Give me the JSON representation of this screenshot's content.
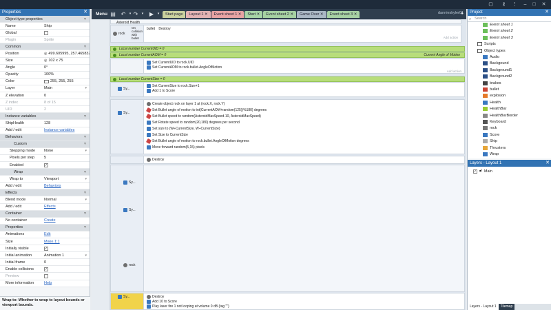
{
  "toolbar": {
    "menu_label": "Menu",
    "user_label": "dannieskyler01",
    "tabs": [
      {
        "label": "Start page",
        "color": "#c9d19e"
      },
      {
        "label": "Layout 1",
        "color": "#e3b3b3"
      },
      {
        "label": "Event sheet 1",
        "color": "#e7a3a3"
      },
      {
        "label": "Start",
        "color": "#a7d4a6"
      },
      {
        "label": "Event sheet 2",
        "color": "#a6d1a2"
      },
      {
        "label": "Game Over",
        "color": "#aab7c4"
      },
      {
        "label": "Event sheet 3",
        "color": "#a7d1a3"
      }
    ]
  },
  "properties": {
    "title": "Properties",
    "rows": [
      {
        "type": "sec",
        "key": "Object type properties"
      },
      {
        "key": "Name",
        "value": "Ship"
      },
      {
        "key": "Global",
        "value": "",
        "check": false
      },
      {
        "key": "Plugin",
        "value": "Sprite",
        "dim": true
      },
      {
        "type": "sec",
        "key": "Common"
      },
      {
        "key": "Position",
        "value": "499.605995, 257.465832",
        "icon": "position-icon"
      },
      {
        "key": "Size",
        "value": "102 x 75",
        "icon": "size-icon"
      },
      {
        "key": "Angle",
        "value": "0°"
      },
      {
        "key": "Opacity",
        "value": "100%"
      },
      {
        "key": "Color",
        "value": "255, 255, 255",
        "swatch": true
      },
      {
        "key": "Layer",
        "value": "Main",
        "dropdown": true
      },
      {
        "key": "Z elevation",
        "value": "0"
      },
      {
        "key": "Z index",
        "value": "8 of 15",
        "dim": true
      },
      {
        "key": "UID",
        "value": "2",
        "dim": true
      },
      {
        "type": "sec",
        "key": "Instance variables"
      },
      {
        "key": "ShipHealth",
        "value": "128"
      },
      {
        "key": "Add / edit",
        "value": "Instance variables",
        "link": true
      },
      {
        "type": "sec",
        "key": "Behaviors"
      },
      {
        "type": "sub",
        "key": "Custom"
      },
      {
        "key": "Stepping mode",
        "value": "None",
        "dropdown": true,
        "sub": true
      },
      {
        "key": "Pixels per step",
        "value": "5",
        "sub": true
      },
      {
        "key": "Enabled",
        "value": "",
        "check": true,
        "sub": true
      },
      {
        "type": "sub",
        "key": "Wrap"
      },
      {
        "key": "Wrap to",
        "value": "Viewport",
        "dropdown": true,
        "sub": true
      },
      {
        "key": "Add / edit",
        "value": "Behaviors",
        "link": true
      },
      {
        "type": "sec",
        "key": "Effects"
      },
      {
        "key": "Blend mode",
        "value": "Normal",
        "dropdown": true
      },
      {
        "key": "Add / edit",
        "value": "Effects",
        "link": true
      },
      {
        "type": "sec",
        "key": "Container"
      },
      {
        "key": "No container",
        "value": "Create",
        "link": true
      },
      {
        "type": "sec",
        "key": "Properties"
      },
      {
        "key": "Animations",
        "value": "Edit",
        "link": true
      },
      {
        "key": "Size",
        "value": "Make 1:1",
        "link": true
      },
      {
        "key": "Initially visible",
        "value": "",
        "check": true
      },
      {
        "key": "Initial animation",
        "value": "Animation 1",
        "dropdown": true
      },
      {
        "key": "Initial frame",
        "value": "0"
      },
      {
        "key": "Enable collisions",
        "value": "",
        "check": true
      },
      {
        "key": "Preview",
        "value": "",
        "check": false,
        "dim": true
      },
      {
        "key": "More information",
        "value": "Help",
        "link": true
      }
    ],
    "tip": "Wrap to: Whether to wrap to layout bounds or viewport bounds."
  },
  "events": {
    "top_text": [
      "Asteroid Health"
    ],
    "e1": {
      "cond_label": "rock",
      "cond_detail": "On collision with bullet",
      "act": "Destroy",
      "act_obj": "bullet"
    },
    "var1": "Local number CurrentUID = 0",
    "var2": "Local number CurrentAOM = 0",
    "var2_right": "Current Angle of Motion",
    "e2": [
      "Set CurrentUID to rock.UID",
      "Set CurrentAOM to rock.bullet.AngleOfMotion"
    ],
    "var3": "Local number CurrentSize = 0",
    "e3": [
      "Set CurrentSize to rock.Size+1",
      "Add 1 to Score"
    ],
    "e4": [
      "Create object  rock on layer 1 at (rock.X, rock.Y)",
      "Set  Bullet angle of motion to int(CurrentAOM+random(125))%180) degrees",
      "Set  Bullet speed to random(AsteroidMaxSpeed-10, AsteroidMaxSpeed)",
      "Set  Rotate speed to random(20,180) degrees per second",
      "Set size to (W÷CurrentSize, W÷CurrentSize)",
      "Set Size to CurrentSize",
      "Set  Bullet angle of motion to rock.bullet.AngleOfMotion degrees",
      "Move forward random(5,15) pixels"
    ],
    "e5": "Destroy",
    "e6": [
      "Destroy",
      "Add 10 to Score",
      "Play laser fire 1 not looping at volume 0 dB (tag \"\")"
    ],
    "add_action": "Add action"
  },
  "project": {
    "title": "Project",
    "search_placeholder": "Search",
    "items": [
      {
        "label": "Event sheet 1",
        "indent": 2,
        "icon": "event-sheet-icon",
        "italic": true
      },
      {
        "label": "Event sheet 2",
        "indent": 2,
        "icon": "event-sheet-icon",
        "italic": true
      },
      {
        "label": "Event sheet 3",
        "indent": 2,
        "icon": "event-sheet-icon",
        "italic": true
      },
      {
        "label": "Scripts",
        "indent": 1,
        "icon": "folder-icon"
      },
      {
        "label": "Object types",
        "indent": 1,
        "icon": "folder-icon"
      },
      {
        "label": "Audio",
        "indent": 2,
        "icon": "audio-icon"
      },
      {
        "label": "Backgound",
        "indent": 2,
        "icon": "image-icon"
      },
      {
        "label": "Background1",
        "indent": 2,
        "icon": "image-icon"
      },
      {
        "label": "Background2",
        "indent": 2,
        "icon": "image-icon"
      },
      {
        "label": "brakes",
        "indent": 2,
        "icon": "brakes-icon"
      },
      {
        "label": "bullet",
        "indent": 2,
        "icon": "bullet-icon"
      },
      {
        "label": "explosion",
        "indent": 2,
        "icon": "explosion-icon"
      },
      {
        "label": "Health",
        "indent": 2,
        "icon": "health-icon"
      },
      {
        "label": "HealthBar",
        "indent": 2,
        "icon": "healthbar-icon"
      },
      {
        "label": "HealthBarBorder",
        "indent": 2,
        "icon": "healthbar-border-icon"
      },
      {
        "label": "Keyboard",
        "indent": 2,
        "icon": "keyboard-icon"
      },
      {
        "label": "rock",
        "indent": 2,
        "icon": "rock-icon"
      },
      {
        "label": "Score",
        "indent": 2,
        "icon": "score-icon"
      },
      {
        "label": "Ship",
        "indent": 2,
        "icon": "ship-icon"
      },
      {
        "label": "Thrusters",
        "indent": 2,
        "icon": "thrusters-icon"
      },
      {
        "label": "Wrap",
        "indent": 2,
        "icon": "wrap-icon"
      }
    ]
  },
  "layers": {
    "title": "Layers - Layout 1",
    "items": [
      {
        "label": "Main"
      }
    ],
    "bottom_tabs": [
      "Layers - Layout 1",
      "Tilemap"
    ]
  },
  "colors": {
    "accent": "#3273b3",
    "variable_row": "#b7dd7a",
    "score_highlight": "#f1d34a"
  }
}
